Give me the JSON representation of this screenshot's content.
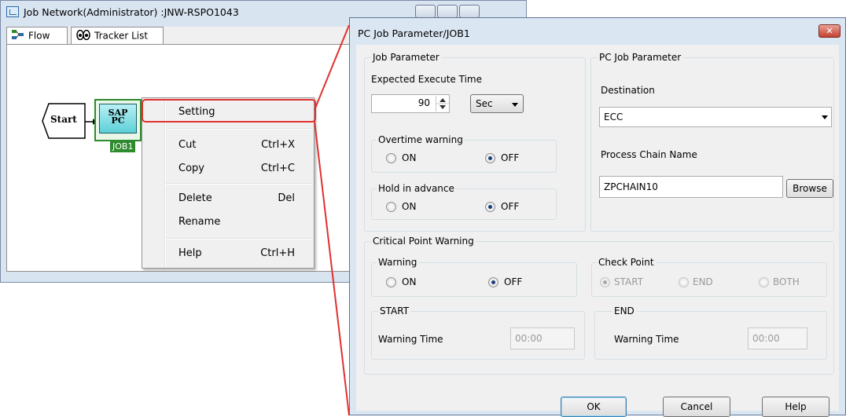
{
  "background_window": {
    "title": "Job Network(Administrator) :JNW-RSPO1043",
    "tabs": [
      "Flow",
      "Tracker List"
    ],
    "nodes": {
      "start_label": "Start",
      "sap_label_line1": "SAP",
      "sap_label_line2": "PC",
      "job_label": "JOB1"
    }
  },
  "context_menu": {
    "items": [
      {
        "label": "Setting",
        "shortcut": ""
      },
      {
        "label": "Cut",
        "shortcut": "Ctrl+X"
      },
      {
        "label": "Copy",
        "shortcut": "Ctrl+C"
      },
      {
        "label": "Delete",
        "shortcut": "Del"
      },
      {
        "label": "Rename",
        "shortcut": ""
      },
      {
        "label": "Help",
        "shortcut": "Ctrl+H"
      }
    ]
  },
  "dialog": {
    "title": "PC Job Parameter/JOB1",
    "close_glyph": "✕",
    "job_parameter": {
      "group_label": "Job Parameter",
      "expected_label": "Expected Execute Time",
      "expected_value": "90",
      "unit_value": "Sec",
      "overtime": {
        "label": "Overtime warning",
        "on": "ON",
        "off": "OFF",
        "selected": "OFF"
      },
      "hold": {
        "label": "Hold in advance",
        "on": "ON",
        "off": "OFF",
        "selected": "OFF"
      }
    },
    "pc_job_parameter": {
      "group_label": "PC Job Parameter",
      "destination_label": "Destination",
      "destination_value": "ECC",
      "process_chain_label": "Process Chain Name",
      "process_chain_value": "ZPCHAIN10",
      "browse_label": "Browse"
    },
    "critical_point": {
      "group_label": "Critical Point Warning",
      "warning": {
        "label": "Warning",
        "on": "ON",
        "off": "OFF",
        "selected": "OFF"
      },
      "check_point": {
        "label": "Check Point",
        "options": [
          "START",
          "END",
          "BOTH"
        ],
        "selected": "START"
      },
      "start": {
        "label": "START",
        "warning_time_label": "Warning Time",
        "value": "00:00"
      },
      "end": {
        "label": "END",
        "warning_time_label": "Warning Time",
        "value": "00:00"
      }
    },
    "buttons": {
      "ok": "OK",
      "cancel": "Cancel",
      "help": "Help"
    }
  },
  "colors": {
    "highlight_red": "#e03030",
    "node_green": "#2d8a2d",
    "dialog_frame": "#dbe6f3"
  }
}
